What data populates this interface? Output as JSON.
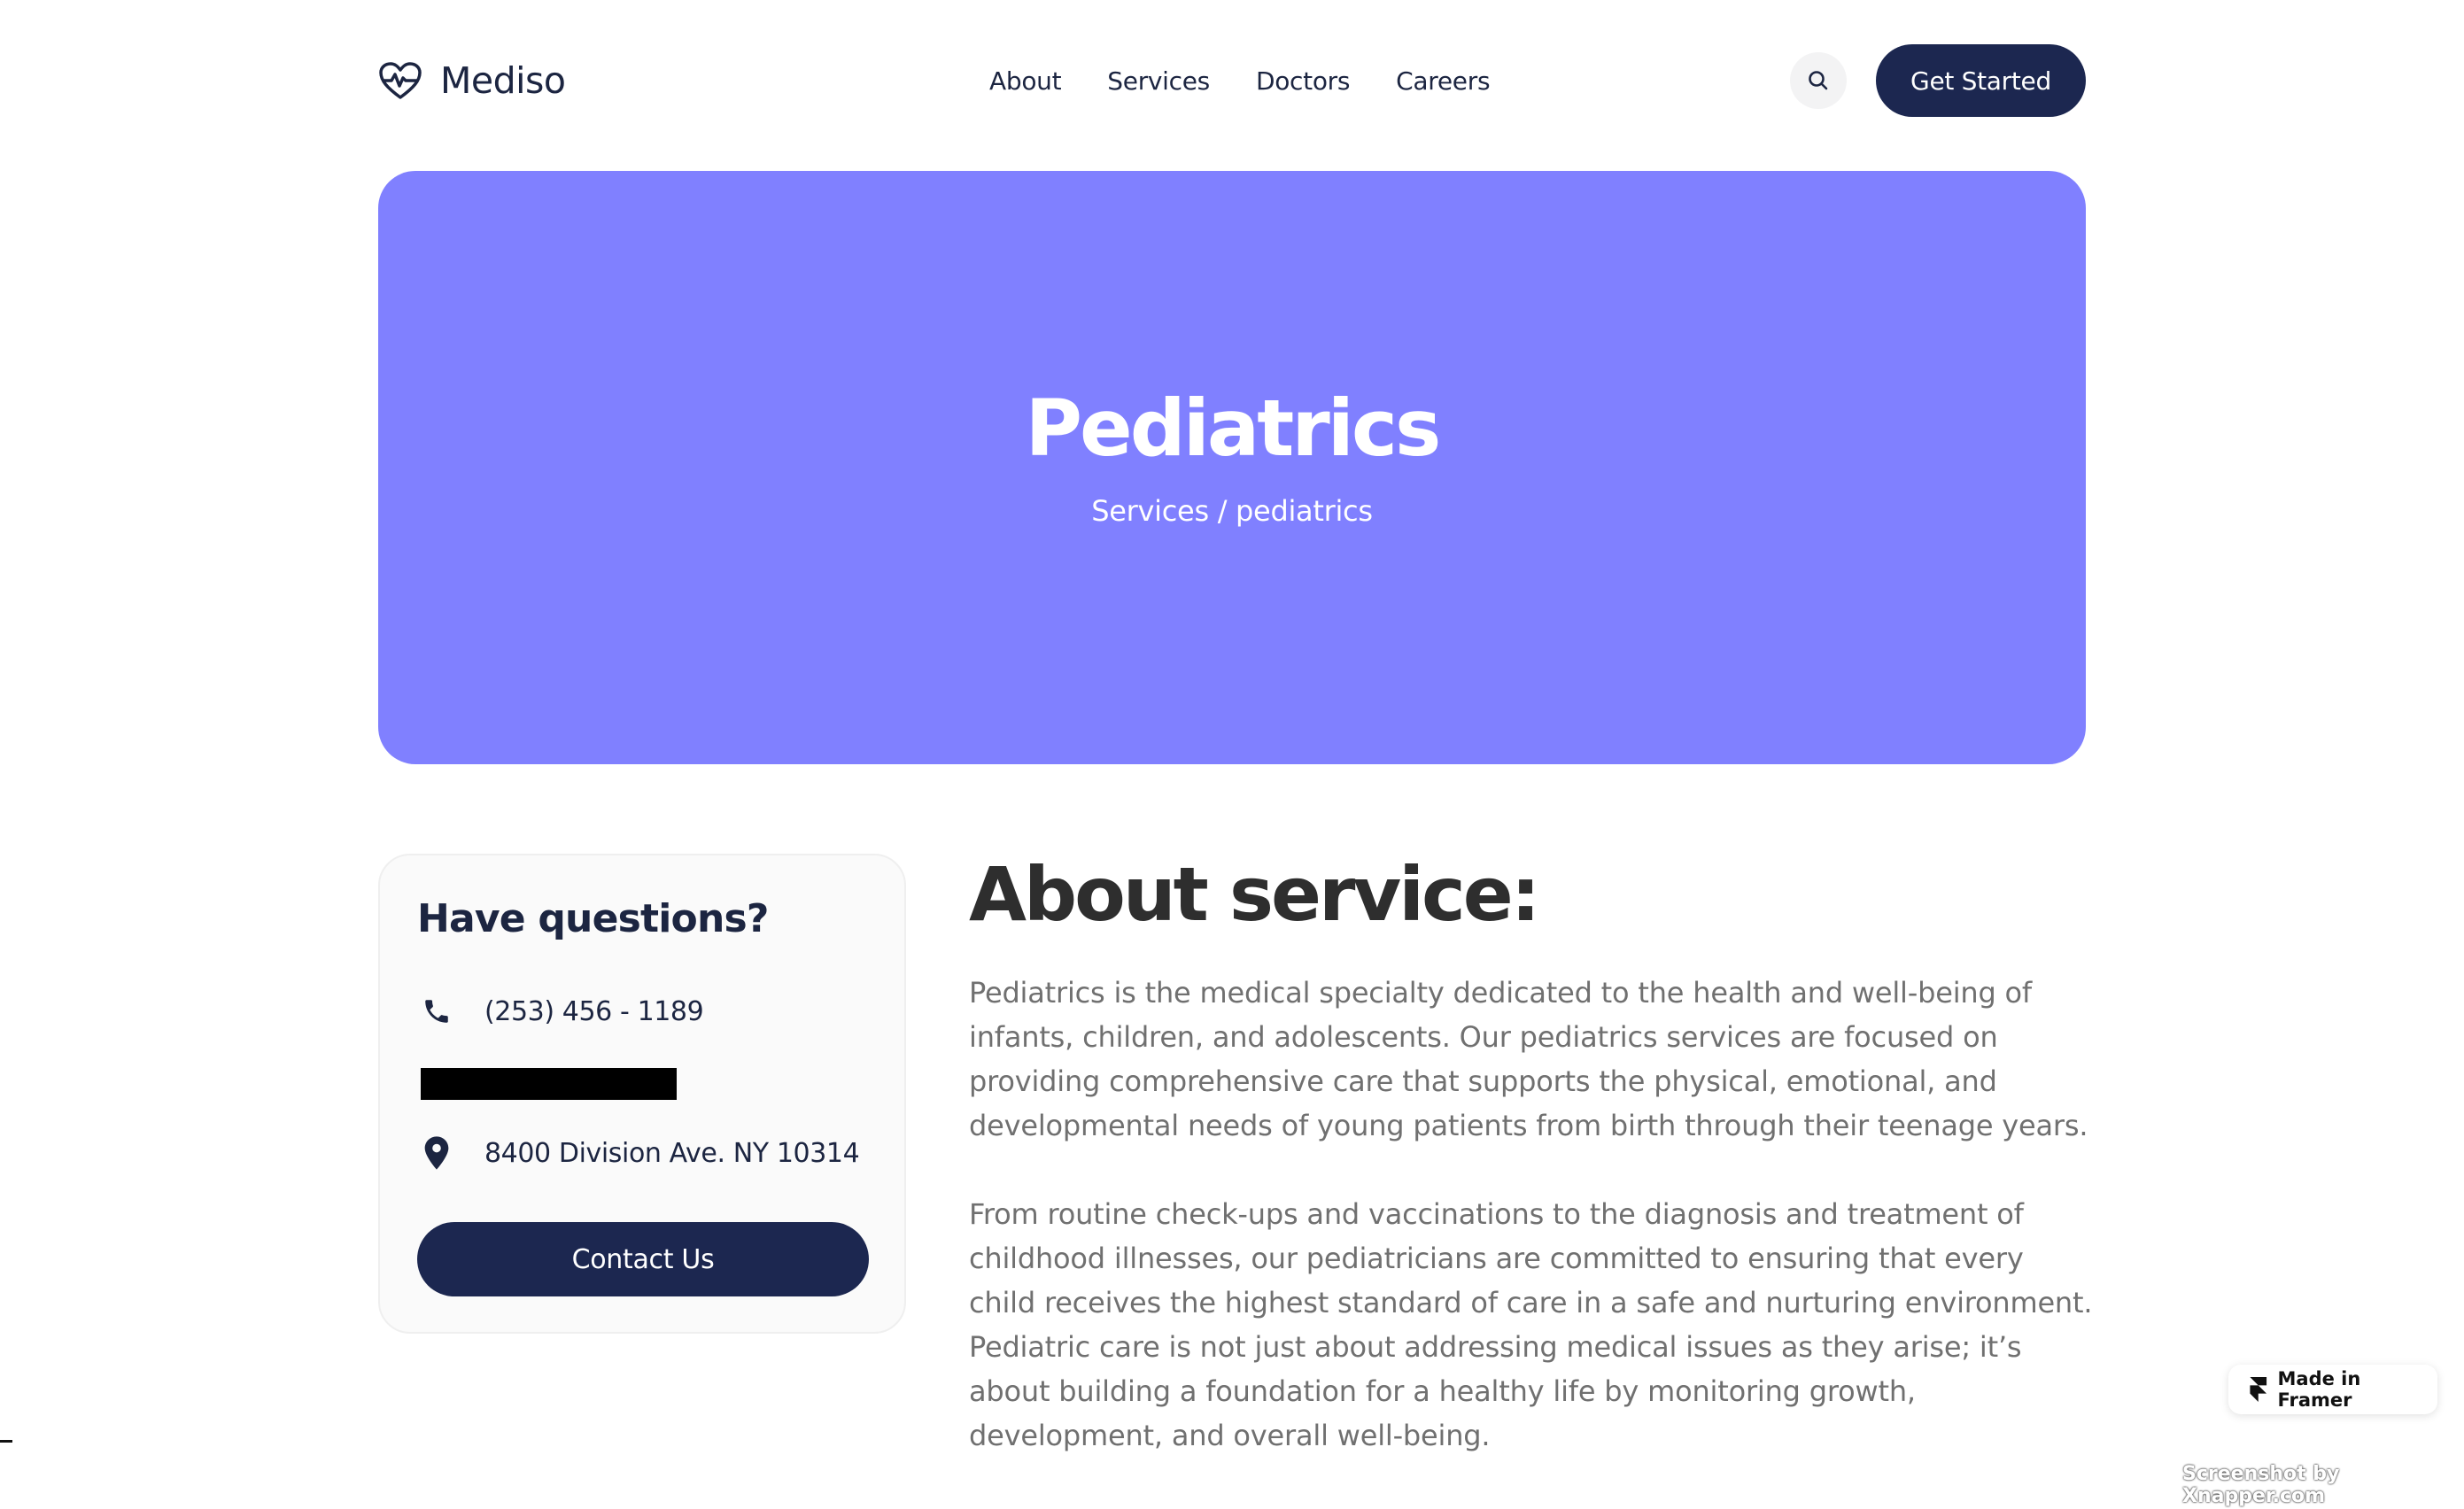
{
  "header": {
    "brand": "Mediso",
    "nav": [
      "About",
      "Services",
      "Doctors",
      "Careers"
    ],
    "cta_label": "Get Started",
    "icons": {
      "logo": "heart-pulse-icon",
      "search": "search-icon"
    }
  },
  "hero": {
    "title": "Pediatrics",
    "breadcrumb": "Services / pediatrics",
    "background": "#8080ff"
  },
  "contact_card": {
    "title": "Have questions?",
    "phone": "(253) 456 - 1189",
    "address": "8400 Division Ave. NY 10314",
    "button_label": "Contact Us",
    "icons": {
      "phone": "phone-icon",
      "address": "location-pin-icon"
    }
  },
  "about": {
    "title": "About service:",
    "paragraphs": [
      "Pediatrics is the medical specialty dedicated to the health and well-being of infants, children, and adolescents. Our pediatrics services are focused on providing comprehensive care that supports the physical, emotional, and developmental needs of young patients from birth through their teenage years.",
      "From routine check-ups and vaccinations to the diagnosis and treatment of childhood illnesses, our pediatricians are committed to ensuring that every child receives the highest standard of care in a safe and nurturing environment. Pediatric care is not just about addressing medical issues as they arise; it’s about building a foundation for a healthy life by monitoring growth, development, and overall well-being."
    ]
  },
  "badge": {
    "label": "Made in Framer",
    "icon": "framer-icon"
  },
  "watermark": "Screenshot by Xnapper.com",
  "colors": {
    "primary": "#1c2750",
    "accent": "#8080ff",
    "text": "#1c2541",
    "muted": "#707070"
  }
}
